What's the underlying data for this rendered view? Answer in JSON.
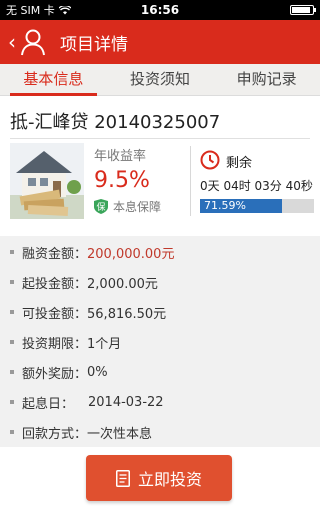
{
  "status_bar": {
    "carrier": "无 SIM 卡",
    "time": "16:56"
  },
  "header": {
    "title": "项目详情",
    "back_icon": "chevron-left-icon",
    "person_icon": "person-icon"
  },
  "tabs": [
    {
      "label": "基本信息",
      "active": true
    },
    {
      "label": "投资须知",
      "active": false
    },
    {
      "label": "申购记录",
      "active": false
    }
  ],
  "product": {
    "title": "抵-汇峰贷 20140325007",
    "rate_label": "年收益率",
    "rate_value": "9.5%",
    "guarantee_badge": "保",
    "guarantee_label": "本息保障",
    "remain_label": "剩余",
    "countdown": "0天 04时 03分 40秒",
    "progress_text": "71.59%",
    "progress": 0.7159
  },
  "details": [
    {
      "label": "融资金额：",
      "value": "200,000.00元",
      "highlight": true
    },
    {
      "label": "起投金额：",
      "value": "2,000.00元"
    },
    {
      "label": "可投金额：",
      "value": "56,816.50元"
    },
    {
      "label": "投资期限：",
      "value": "1个月"
    },
    {
      "label": "额外奖励：",
      "value": "0%"
    },
    {
      "label": "起息日：",
      "value": "2014-03-22"
    },
    {
      "label": "回款方式：",
      "value": "一次性本息"
    }
  ],
  "invest_button": {
    "label": "立即投资"
  },
  "colors": {
    "brand_red": "#d92b1c",
    "button": "#e0502f",
    "progress_blue": "#2a6fba",
    "highlight": "#c0392b"
  }
}
